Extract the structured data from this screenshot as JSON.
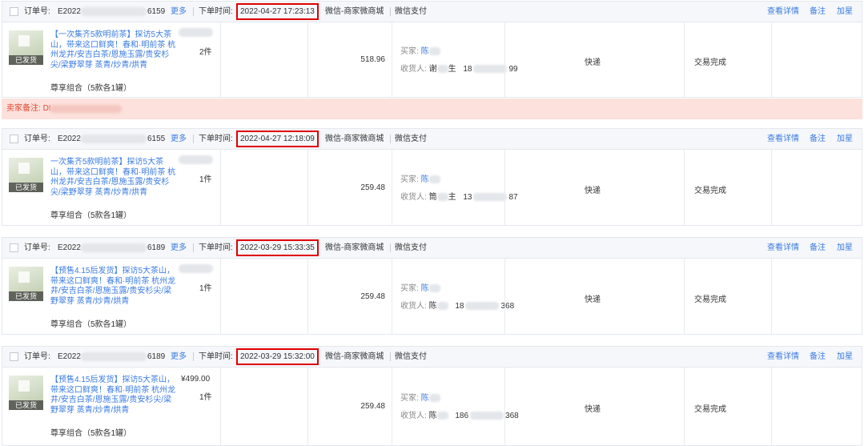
{
  "labels": {
    "order_no": "订单号:",
    "more": "更多",
    "order_time": "下单时间:",
    "detail": "查看详情",
    "note": "备注",
    "star": "加星",
    "buyer": "买家:",
    "receiver": "收货人:",
    "shipped_tag": "已发货",
    "seller_remark": "卖家备注:"
  },
  "seller_remark_value": "DI",
  "orders": [
    {
      "order_prefix": "E2022",
      "order_suffix": "6159",
      "time": "2022-04-27 17:23:13",
      "channel": "微信-商家微商城",
      "payment": "微信支付",
      "title": "【一次集齐5款明前茶】探访5大茶山，带来这口鲜爽！春和·明前茶 杭州龙井/安吉白茶/恩施玉露/贵安杉尖/梁野翠芽 蒸青/炒青/烘青",
      "sku": "尊享组合（5款各1罐）",
      "price": "",
      "qty": "2件",
      "amount": "518.96",
      "buyer": "陈",
      "receiver_a": "谢",
      "receiver_b": "生",
      "phone_pre": "18",
      "phone_suf": "99",
      "shipping": "快递",
      "status": "交易完成"
    },
    {
      "order_prefix": "E2022",
      "order_suffix": "6155",
      "time": "2022-04-27 12:18:09",
      "channel": "微信-商家微商城",
      "payment": "微信支付",
      "title": "一次集齐5款明前茶】探访5大茶山，带来这口鲜爽！春和·明前茶 杭州龙井/安吉白茶/恩施玉露/贵安杉尖/梁野翠芽 蒸青/炒青/烘青",
      "sku": "尊享组合（5款各1罐）",
      "price": "",
      "qty": "1件",
      "amount": "259.48",
      "buyer": "陈",
      "receiver_a": "筒",
      "receiver_b": "主",
      "phone_pre": "13",
      "phone_suf": "87",
      "shipping": "快递",
      "status": "交易完成"
    },
    {
      "order_prefix": "E2022",
      "order_suffix": "6189",
      "time": "2022-03-29 15:33:35",
      "channel": "微信-商家微商城",
      "payment": "微信支付",
      "title": "【预售4.15后发货】探访5大茶山，带来这口鲜爽！春和·明前茶 杭州龙井/安吉白茶/恩施玉露/贵安杉尖/梁野翠芽 蒸青/炒青/烘青",
      "sku": "尊享组合（5款各1罐）",
      "price": "",
      "qty": "1件",
      "amount": "259.48",
      "buyer": "陈",
      "receiver_a": "陈",
      "receiver_b": "",
      "phone_pre": "18",
      "phone_suf": "368",
      "shipping": "快递",
      "status": "交易完成"
    },
    {
      "order_prefix": "E2022",
      "order_suffix": "6189",
      "time": "2022-03-29 15:32:00",
      "channel": "微信-商家微商城",
      "payment": "微信支付",
      "title": "【预售4.15后发货】探访5大茶山，带来这口鲜爽！春和·明前茶 杭州龙井/安吉白茶/恩施玉露/贵安杉尖/梁野翠芽 蒸青/炒青/烘青",
      "sku": "尊享组合（5款各1罐）",
      "price": "¥499.00",
      "qty": "1件",
      "amount": "259.48",
      "buyer": "陈",
      "receiver_a": "陈",
      "receiver_b": "",
      "phone_pre": "186",
      "phone_suf": "368",
      "shipping": "快递",
      "status": "交易完成"
    }
  ]
}
